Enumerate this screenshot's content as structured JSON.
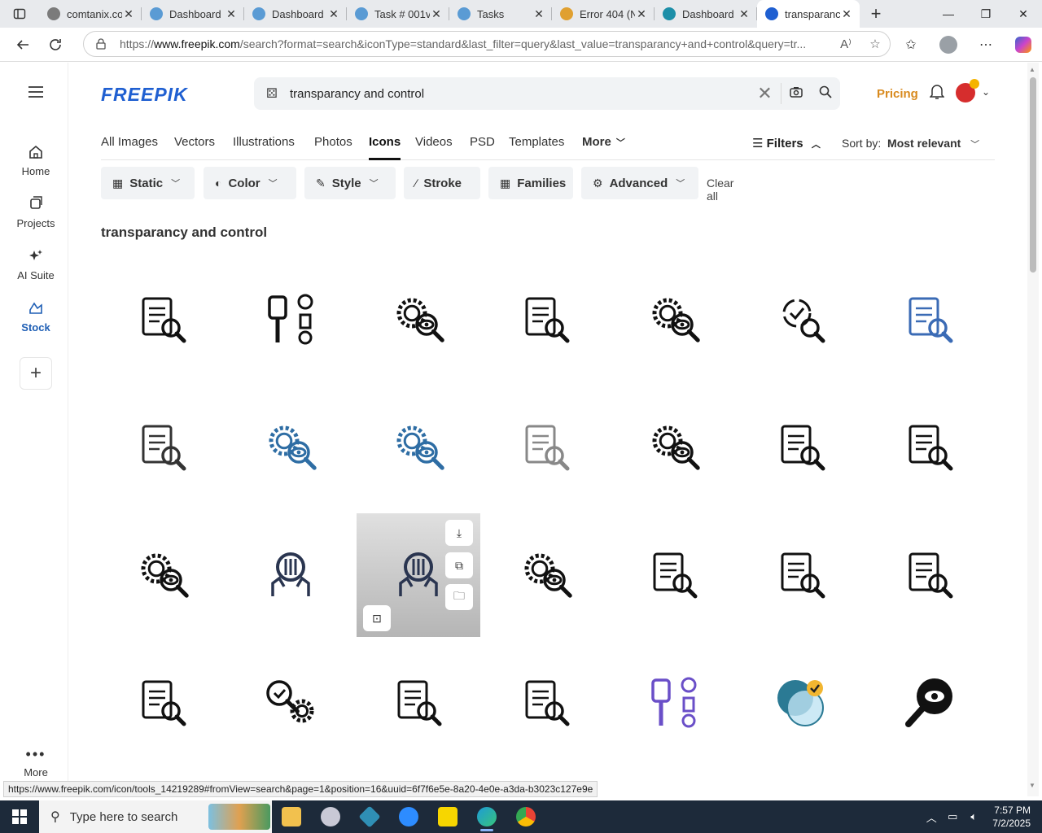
{
  "browser": {
    "tabs": [
      {
        "title": "comtanix.com",
        "color": "#7b7b7b"
      },
      {
        "title": "Dashboard",
        "color": "#5a9bd4"
      },
      {
        "title": "Dashboard",
        "color": "#5a9bd4"
      },
      {
        "title": "Task # 001v",
        "color": "#5a9bd4"
      },
      {
        "title": "Tasks",
        "color": "#5a9bd4"
      },
      {
        "title": "Error 404 (N",
        "color": "#e0a030"
      },
      {
        "title": "Dashboard",
        "color": "#1d8fa8"
      },
      {
        "title": "transparancy",
        "color": "#1f5fd1",
        "active": true
      }
    ],
    "url_prefix": "https://",
    "url_domain": "www.freepik.com",
    "url_rest": "/search?format=search&iconType=standard&last_filter=query&last_value=transparancy+and+control&query=tr..."
  },
  "sidebar": {
    "items": [
      {
        "label": "Home",
        "icon": "home-icon"
      },
      {
        "label": "Projects",
        "icon": "projects-icon"
      },
      {
        "label": "AI Suite",
        "icon": "sparkle-icon"
      },
      {
        "label": "Stock",
        "icon": "stock-icon",
        "active": true
      }
    ],
    "more_label": "More"
  },
  "header": {
    "logo": "FREEPIK",
    "search_value": "transparancy and control",
    "pricing": "Pricing"
  },
  "type_tabs": [
    "All Images",
    "Vectors",
    "Illustrations",
    "Photos",
    "Icons",
    "Videos",
    "PSD",
    "Templates",
    "More"
  ],
  "active_type": "Icons",
  "filters_label": "Filters",
  "sort": {
    "label": "Sort by:",
    "value": "Most relevant"
  },
  "chips": [
    "Static",
    "Color",
    "Style",
    "Stroke",
    "Families",
    "Advanced"
  ],
  "clear_all": "Clear all",
  "results_title": "transparancy and control",
  "icons": [
    {
      "name": "clipboard-eye-icon",
      "color": "#111"
    },
    {
      "name": "eye-sliders-check-icon",
      "color": "#111"
    },
    {
      "name": "gear-eye-search-icon",
      "color": "#111"
    },
    {
      "name": "checklist-eye-search-icon",
      "color": "#111"
    },
    {
      "name": "eye-gear-icon",
      "color": "#111"
    },
    {
      "name": "check-cycle-search-icon",
      "color": "#111"
    },
    {
      "name": "checklist-eye-blue-icon",
      "color": "#3b6bb5"
    },
    {
      "name": "document-gear-eye-icon",
      "color": "#333"
    },
    {
      "name": "gear-eye-blue-icon",
      "color": "#2e6da4"
    },
    {
      "name": "gear-eye-blue-2-icon",
      "color": "#2e6da4"
    },
    {
      "name": "checklist-search-light-icon",
      "color": "#888"
    },
    {
      "name": "gear-eye-bold-icon",
      "color": "#111"
    },
    {
      "name": "checklist-eye-bold-icon",
      "color": "#111"
    },
    {
      "name": "clipboard-search-bold-icon",
      "color": "#111"
    },
    {
      "name": "gear-eye-magnifier-icon",
      "color": "#111"
    },
    {
      "name": "hands-sliders-icon",
      "color": "#2a3550"
    },
    {
      "name": "hands-sliders-hover-icon",
      "color": "#2a3550"
    },
    {
      "name": "gear-cycle-eye-icon",
      "color": "#111"
    },
    {
      "name": "checklist-eye-outline-icon",
      "color": "#111"
    },
    {
      "name": "document-checklist-eye-icon",
      "color": "#111"
    },
    {
      "name": "clipboard-eye-bold-icon",
      "color": "#111"
    },
    {
      "name": "clipboard-eye-solid-icon",
      "color": "#111"
    },
    {
      "name": "search-check-gears-icon",
      "color": "#111"
    },
    {
      "name": "clipboard-search-solid-icon",
      "color": "#111"
    },
    {
      "name": "checklist-eye-solid-icon",
      "color": "#111"
    },
    {
      "name": "sliders-check-purple-icon",
      "color": "#6a4fc8"
    },
    {
      "name": "circles-check-color-icon",
      "color": "#2b7a94"
    },
    {
      "name": "gear-eye-magnifier-solid-icon",
      "color": "#111"
    }
  ],
  "status_url": "https://www.freepik.com/icon/tools_14219289#fromView=search&page=1&position=16&uuid=6f7f6e5e-8a20-4e0e-a3da-b3023c127e9e",
  "taskbar": {
    "search_placeholder": "Type here to search",
    "time": "7:57 PM",
    "date": "7/2/2025"
  },
  "colors": {
    "accent": "#1f5fd1",
    "pricing": "#d88a1e",
    "taskbar": "#1d2a3a"
  }
}
